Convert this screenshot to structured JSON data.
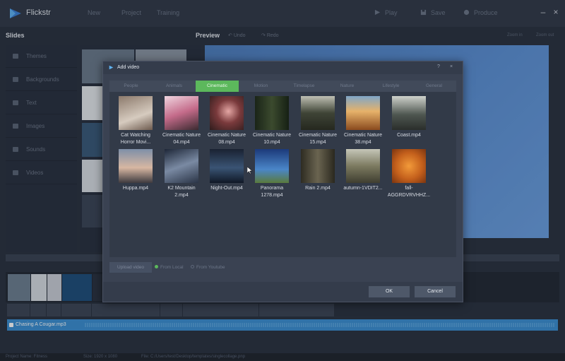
{
  "app": {
    "name": "Flickstr"
  },
  "menu": [
    "New",
    "Project",
    "Training"
  ],
  "toolbar": {
    "play": "Play",
    "save": "Save",
    "produce": "Produce"
  },
  "header": {
    "slides": "Slides",
    "preview": "Preview",
    "undo": "Undo",
    "redo": "Redo",
    "zoom_in": "Zoom in",
    "zoom_out": "Zoom out"
  },
  "sidebar": {
    "items": [
      {
        "label": "Themes",
        "icon": "themes-icon"
      },
      {
        "label": "Backgrounds",
        "icon": "backgrounds-icon"
      },
      {
        "label": "Text",
        "icon": "text-icon"
      },
      {
        "label": "Images",
        "icon": "images-icon"
      },
      {
        "label": "Sounds",
        "icon": "sounds-icon"
      },
      {
        "label": "Videos",
        "icon": "videos-icon"
      }
    ]
  },
  "dialog": {
    "title": "Add video",
    "help": "?",
    "close": "×",
    "tabs": [
      "People",
      "Animals",
      "Cinematic",
      "Motion",
      "Timelapse",
      "Nature",
      "Lifestyle",
      "General"
    ],
    "active_tab": "Cinematic",
    "videos": [
      {
        "name": "Cat Watching\nHorror Movi...",
        "color": "#b7a79a"
      },
      {
        "name": "Cinematic Nature\n04.mp4",
        "color": "#d9b0c4"
      },
      {
        "name": "Cinematic Nature\n08.mp4",
        "color": "#6b3f3c"
      },
      {
        "name": "Cinematic Nature\n10.mp4",
        "color": "#2c3a26"
      },
      {
        "name": "Cinematic Nature\n15.mp4",
        "color": "#4a4f43"
      },
      {
        "name": "Cinematic Nature\n38.mp4",
        "color": "#c98a4b"
      },
      {
        "name": "Coast.mp4",
        "color": "#6e7570"
      },
      {
        "name": "Huppa.mp4",
        "color": "#c7a896"
      },
      {
        "name": "K2 Mountain\n2.mp4",
        "color": "#59677e"
      },
      {
        "name": "Night-Out.mp4",
        "color": "#273448"
      },
      {
        "name": "Panorama\n1278.mp4",
        "color": "#3f6fb1"
      },
      {
        "name": "Rain 2.mp4",
        "color": "#54513f"
      },
      {
        "name": "autumn-1VDIT2...",
        "color": "#8a8a72"
      },
      {
        "name": "fall-\nAGGRDVRVHHZ...",
        "color": "#d27427"
      }
    ],
    "upload_button": "Upload video",
    "source_local": "From Local",
    "source_youtube": "From Youtube",
    "ok": "OK",
    "cancel": "Cancel"
  },
  "timeline": {
    "audio_label": "Chasing A Cougar.mp3",
    "project_name": "Project Name: Fitness",
    "size": "Size: 1920 x 1080",
    "file": "File: C:/Users/test/Desktop/templates/singlecollage.pnp"
  },
  "colors": {
    "accent": "#5cb85c",
    "audio": "#3c8fd2",
    "preview": "#5a8ed3"
  }
}
